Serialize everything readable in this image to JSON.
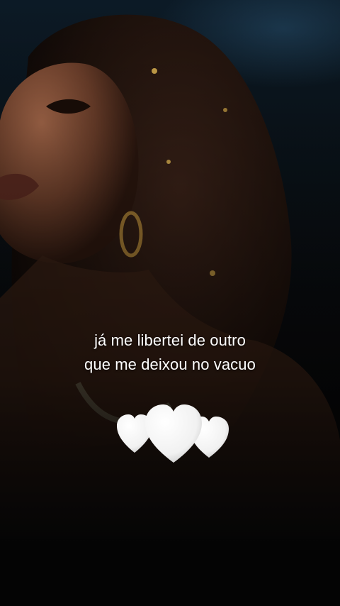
{
  "video": {
    "caption_lines": [
      "já me libertei de outro",
      "que me deixou no vacuo"
    ]
  },
  "sticker": {
    "icon": "white-hearts-icon",
    "color": "#ffffff"
  }
}
